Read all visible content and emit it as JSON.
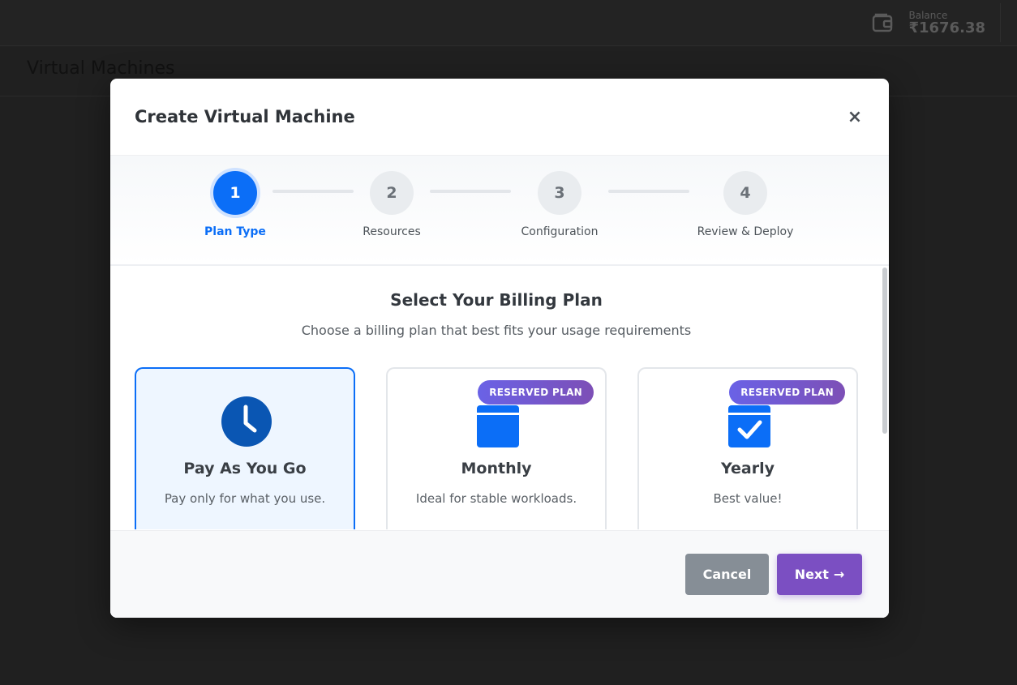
{
  "topbar": {
    "balance_label": "Balance",
    "balance_value": "₹1676.38"
  },
  "page": {
    "heading": "Virtual Machines"
  },
  "modal": {
    "title": "Create Virtual Machine",
    "close_icon": "×",
    "steps": [
      {
        "number": "1",
        "label": "Plan Type",
        "active": true
      },
      {
        "number": "2",
        "label": "Resources",
        "active": false
      },
      {
        "number": "3",
        "label": "Configuration",
        "active": false
      },
      {
        "number": "4",
        "label": "Review & Deploy",
        "active": false
      }
    ],
    "section_title": "Select Your Billing Plan",
    "section_subtitle": "Choose a billing plan that best fits your usage requirements",
    "plans": [
      {
        "name": "Pay As You Go",
        "description": "Pay only for what you use.",
        "icon": "clock-icon",
        "badge": "",
        "selected": true
      },
      {
        "name": "Monthly",
        "description": "Ideal for stable workloads.",
        "icon": "calendar-icon",
        "badge": "RESERVED PLAN",
        "selected": false
      },
      {
        "name": "Yearly",
        "description": "Best value!",
        "icon": "calendar-check-icon",
        "badge": "RESERVED PLAN",
        "selected": false
      }
    ],
    "footer": {
      "cancel_label": "Cancel",
      "next_label": "Next",
      "next_icon": "→"
    }
  },
  "colors": {
    "primary": "#0b6ef7",
    "accent": "#7b4fc2",
    "cancel": "#868e96",
    "badge_start": "#6a62e6",
    "badge_end": "#7d4fb6"
  }
}
